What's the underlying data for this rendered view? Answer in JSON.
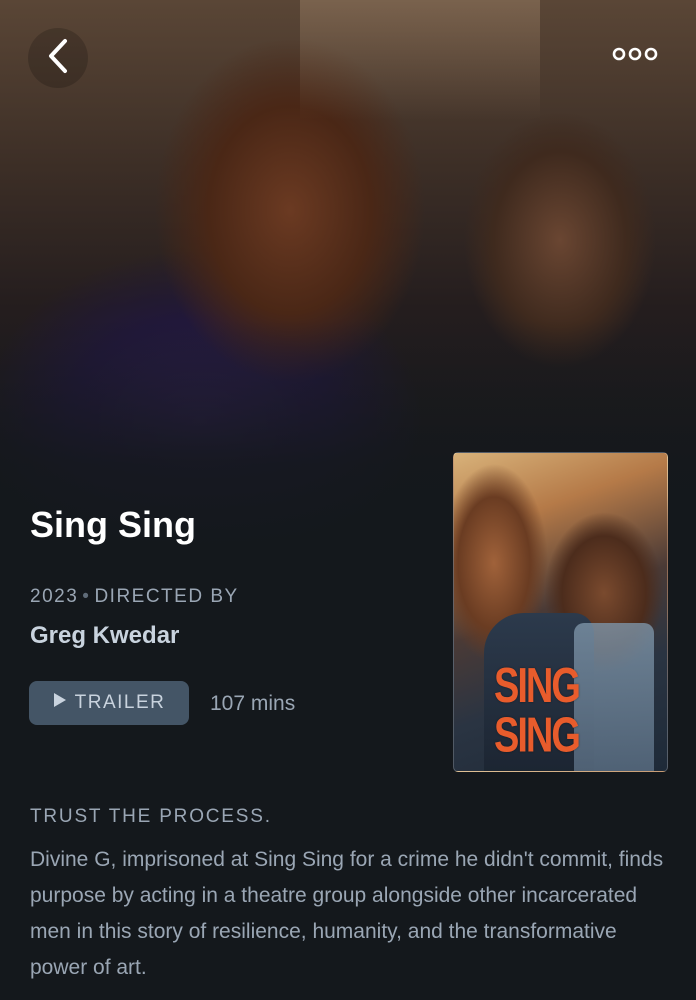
{
  "header": {
    "back_icon": "chevron-left-icon",
    "more_icon": "more-horizontal-icon"
  },
  "film": {
    "title": "Sing Sing",
    "year": "2023",
    "directed_by_label": "DIRECTED BY",
    "director": "Greg Kwedar",
    "trailer_label": "TRAILER",
    "runtime": "107 mins",
    "poster_title": "SING SING",
    "tagline": "TRUST THE PROCESS.",
    "synopsis": "Divine G, imprisoned at Sing Sing for a crime he didn't commit, finds purpose by acting in a theatre group alongside other incarcerated men in this story of resilience, humanity, and the transformative power of art."
  },
  "colors": {
    "background": "#14181c",
    "muted_text": "#9aa6b4",
    "director_text": "#c9d3de",
    "button_bg": "#445566",
    "poster_title": "#e85c2c"
  }
}
